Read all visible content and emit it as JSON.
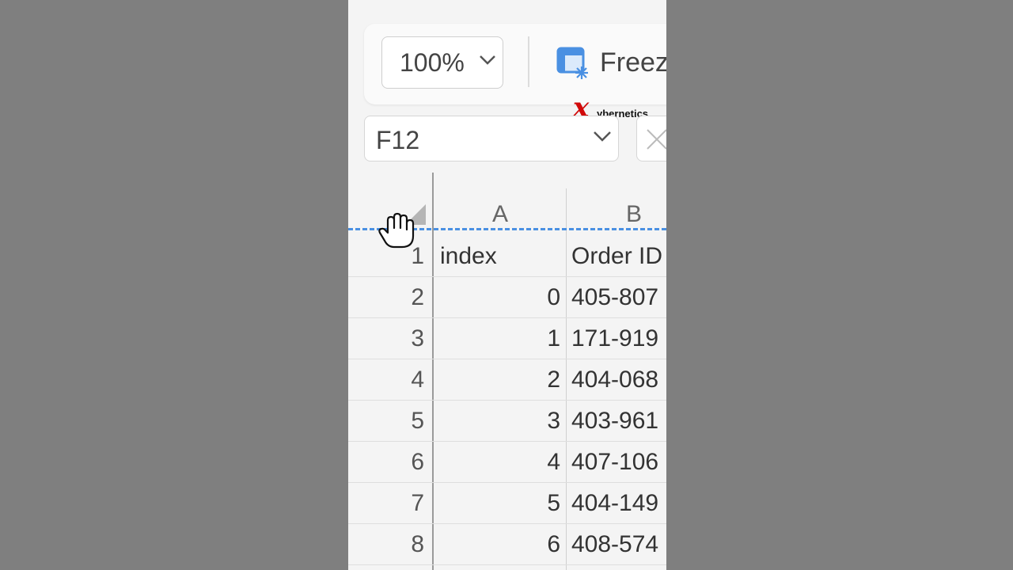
{
  "toolbar": {
    "zoom_value": "100%",
    "freeze_label": "Freez"
  },
  "watermark": {
    "mark": "x",
    "text": "ybernetics"
  },
  "formula_bar": {
    "name_box": "F12"
  },
  "grid": {
    "columns": [
      "A",
      "B"
    ],
    "rows": [
      {
        "num": "1",
        "a": "index",
        "b": "Order ID"
      },
      {
        "num": "2",
        "a": "0",
        "b": "405-807"
      },
      {
        "num": "3",
        "a": "1",
        "b": "171-919"
      },
      {
        "num": "4",
        "a": "2",
        "b": "404-068"
      },
      {
        "num": "5",
        "a": "3",
        "b": "403-961"
      },
      {
        "num": "6",
        "a": "4",
        "b": "407-106"
      },
      {
        "num": "7",
        "a": "5",
        "b": "404-149"
      },
      {
        "num": "8",
        "a": "6",
        "b": "408-574"
      }
    ]
  },
  "colors": {
    "freeze_line": "#4a90e2",
    "watermark_red": "#d10a0a",
    "background": "#7f7f7f"
  },
  "icons": [
    "chevron-down-icon",
    "freeze-panes-icon",
    "cancel-icon",
    "hand-cursor-icon",
    "select-all-icon"
  ]
}
